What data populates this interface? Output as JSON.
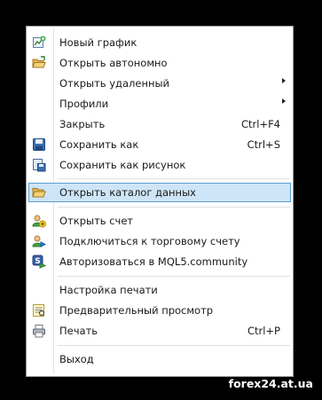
{
  "menu": {
    "items": [
      {
        "label": "Новый график",
        "icon": "new-chart-icon"
      },
      {
        "label": "Открыть автономно",
        "icon": "open-offline-folder-icon"
      },
      {
        "label": "Открыть удаленный",
        "submenu": true
      },
      {
        "label": "Профили",
        "submenu": true
      },
      {
        "label": "Закрыть",
        "shortcut": "Ctrl+F4"
      },
      {
        "label": "Сохранить как",
        "shortcut": "Ctrl+S",
        "icon": "save-disk-icon"
      },
      {
        "label": "Сохранить как рисунок",
        "icon": "save-picture-icon"
      },
      {
        "label": "Открыть каталог данных",
        "icon": "open-folder-icon",
        "highlighted": true
      },
      {
        "label": "Открыть счет",
        "icon": "open-account-user-icon"
      },
      {
        "label": "Подключиться к торговому счету",
        "icon": "connect-account-user-icon"
      },
      {
        "label": "Авторизоваться в MQL5.community",
        "icon": "mql5-login-icon"
      },
      {
        "label": "Настройка печати"
      },
      {
        "label": "Предварительный просмотр",
        "icon": "print-preview-icon"
      },
      {
        "label": "Печать",
        "shortcut": "Ctrl+P",
        "icon": "printer-icon"
      },
      {
        "label": "Выход"
      }
    ]
  },
  "colors": {
    "highlight_bg": "#cde5f7",
    "highlight_border": "#5b9fd4",
    "background": "#000000"
  },
  "watermark": "forex24.at.ua"
}
